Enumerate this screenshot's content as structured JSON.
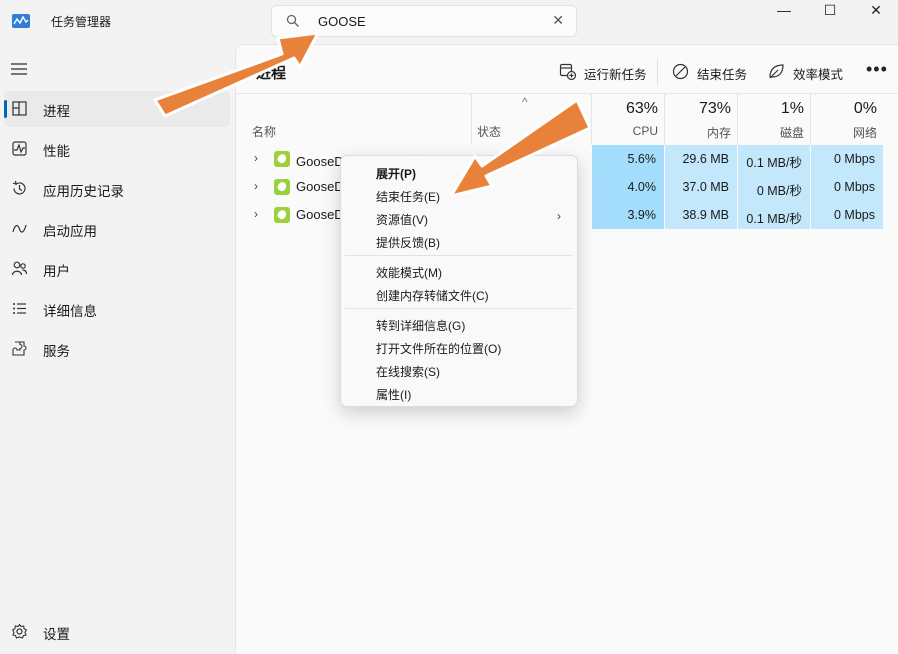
{
  "window": {
    "title": "任务管理器",
    "search_value": "GOOSE",
    "controls": [
      "minimize",
      "maximize",
      "close"
    ]
  },
  "sidebar": {
    "items": [
      {
        "label": "进程",
        "icon": "processes-icon",
        "active": true
      },
      {
        "label": "性能",
        "icon": "performance-icon"
      },
      {
        "label": "应用历史记录",
        "icon": "app-history-icon"
      },
      {
        "label": "启动应用",
        "icon": "startup-icon"
      },
      {
        "label": "用户",
        "icon": "users-icon"
      },
      {
        "label": "详细信息",
        "icon": "details-icon"
      },
      {
        "label": "服务",
        "icon": "services-icon"
      }
    ],
    "settings_label": "设置"
  },
  "toolbar": {
    "page_title": "进程",
    "run_new_task": "运行新任务",
    "end_task": "结束任务",
    "efficiency_mode": "效率模式",
    "more": "•••"
  },
  "table": {
    "name_header": "名称",
    "status_header": "状态",
    "columns": [
      {
        "pct": "63%",
        "label": "CPU"
      },
      {
        "pct": "73%",
        "label": "内存"
      },
      {
        "pct": "1%",
        "label": "磁盘"
      },
      {
        "pct": "0%",
        "label": "网络"
      }
    ],
    "rows": [
      {
        "name": "GooseDesktop (32 位) (3)",
        "cpu": "5.6%",
        "memory": "29.6 MB",
        "disk": "0.1 MB/秒",
        "network": "0 Mbps"
      },
      {
        "name": "GooseDesktop",
        "cpu": "4.0%",
        "memory": "37.0 MB",
        "disk": "0 MB/秒",
        "network": "0 Mbps"
      },
      {
        "name": "GooseDesktop",
        "cpu": "3.9%",
        "memory": "38.9 MB",
        "disk": "0.1 MB/秒",
        "network": "0 Mbps"
      }
    ]
  },
  "context_menu": {
    "expand": "展开(P)",
    "end_task": "结束任务(E)",
    "resource_values": "资源值(V)",
    "feedback": "提供反馈(B)",
    "efficiency_mode": "效能模式(M)",
    "create_dump": "创建内存转储文件(C)",
    "go_to_details": "转到详细信息(G)",
    "open_file_location": "打开文件所在的位置(O)",
    "search_online": "在线搜索(S)",
    "properties": "属性(I)"
  },
  "colors": {
    "accent": "#0067c0",
    "heat_cell": "#a4dcfb",
    "arrow": "#e8823a"
  }
}
